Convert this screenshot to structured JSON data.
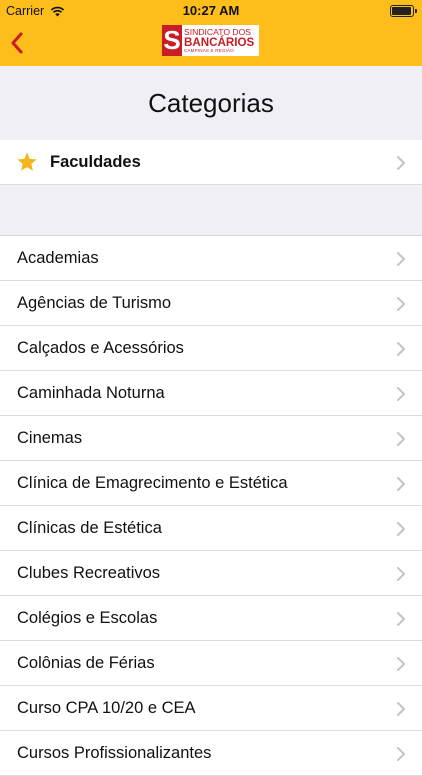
{
  "status_bar": {
    "carrier": "Carrier",
    "time": "10:27 AM"
  },
  "header": {
    "logo": {
      "letter": "S",
      "line1": "SINDICATO DOS",
      "line2": "BANCÁRIOS",
      "line3": "CAMPINAS E REGIÃO"
    },
    "accent_color": "#fdbd1a",
    "back_color": "#c91c24"
  },
  "page_title": "Categorias",
  "favorite": {
    "label": "Faculdades",
    "icon": "star-icon"
  },
  "categories": [
    {
      "label": "Academias"
    },
    {
      "label": "Agências de Turismo"
    },
    {
      "label": "Calçados e Acessórios"
    },
    {
      "label": "Caminhada Noturna"
    },
    {
      "label": "Cinemas"
    },
    {
      "label": "Clínica de Emagrecimento e Estética"
    },
    {
      "label": "Clínicas de Estética"
    },
    {
      "label": "Clubes Recreativos"
    },
    {
      "label": "Colégios e Escolas"
    },
    {
      "label": "Colônias de Férias"
    },
    {
      "label": "Curso CPA 10/20 e CEA"
    },
    {
      "label": "Cursos Profissionalizantes"
    }
  ]
}
